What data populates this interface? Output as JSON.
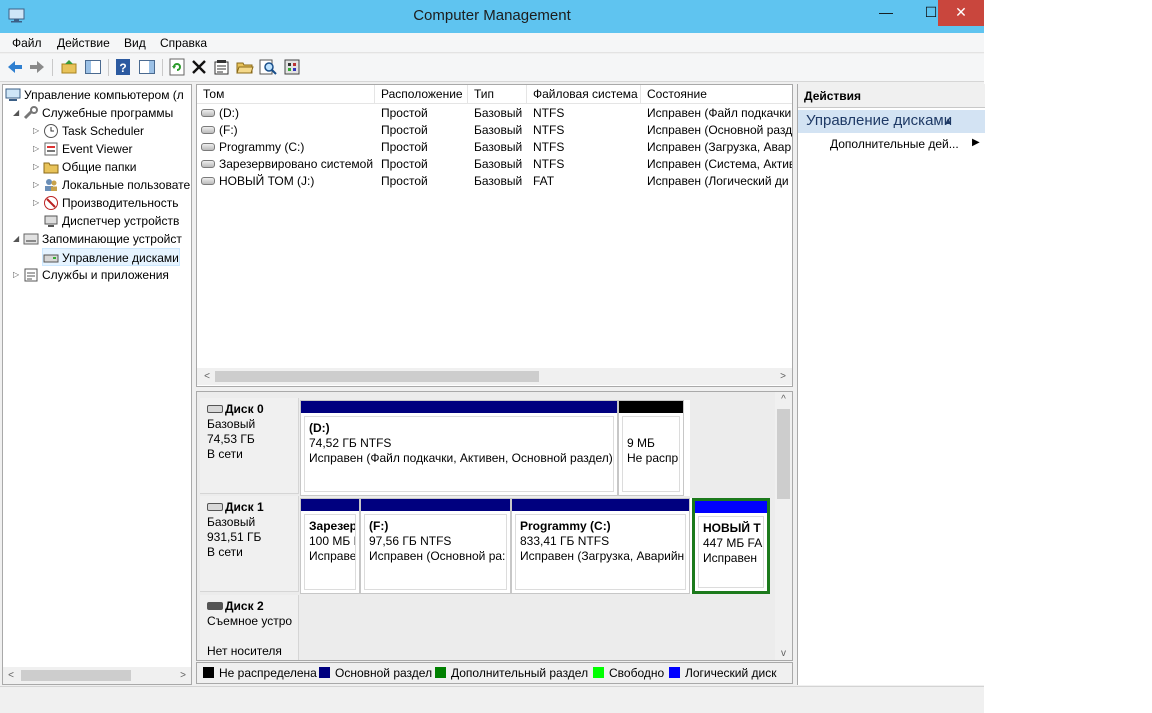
{
  "window": {
    "title": "Computer Management",
    "controls": {
      "minimize": "—",
      "maximize": "☐",
      "close": "✕"
    }
  },
  "menu": [
    "Файл",
    "Действие",
    "Вид",
    "Справка"
  ],
  "toolbar_icons": [
    "back-icon",
    "forward-icon",
    "up-folder-icon",
    "show-hide-tree-icon",
    "help-icon",
    "show-hide-action-icon",
    "refresh-icon",
    "delete-icon",
    "properties-icon",
    "open-icon",
    "search-icon",
    "settings-icon"
  ],
  "tree": {
    "items": [
      {
        "label": "Управление компьютером (л",
        "icon": "computer-icon"
      },
      {
        "label": "Служебные программы",
        "icon": "tools-icon"
      },
      {
        "label": "Task Scheduler",
        "icon": "clock-icon"
      },
      {
        "label": "Event Viewer",
        "icon": "event-viewer-icon"
      },
      {
        "label": "Общие папки",
        "icon": "shared-folder-icon"
      },
      {
        "label": "Локальные пользовате",
        "icon": "users-icon"
      },
      {
        "label": "Производительность",
        "icon": "performance-icon"
      },
      {
        "label": "Диспетчер устройств",
        "icon": "device-manager-icon"
      },
      {
        "label": "Запоминающие устройст",
        "icon": "storage-icon"
      },
      {
        "label": "Управление дисками",
        "icon": "disk-management-icon"
      },
      {
        "label": "Службы и приложения",
        "icon": "services-icon"
      }
    ]
  },
  "volumes": {
    "columns": [
      "Том",
      "Расположение",
      "Тип",
      "Файловая система",
      "Состояние"
    ],
    "rows": [
      [
        "(D:)",
        "Простой",
        "Базовый",
        "NTFS",
        "Исправен (Файл подкачки"
      ],
      [
        "(F:)",
        "Простой",
        "Базовый",
        "NTFS",
        "Исправен (Основной разд"
      ],
      [
        "Programmy (C:)",
        "Простой",
        "Базовый",
        "NTFS",
        "Исправен (Загрузка, Авар"
      ],
      [
        "Зарезервировано системой",
        "Простой",
        "Базовый",
        "NTFS",
        "Исправен (Система, Актив"
      ],
      [
        "НОВЫЙ ТОМ (J:)",
        "Простой",
        "Базовый",
        "FAT",
        "Исправен (Логический ди"
      ]
    ]
  },
  "disks": [
    {
      "name": "Диск 0",
      "type": "Базовый",
      "size": "74,53 ГБ",
      "status": "В сети",
      "partitions": [
        {
          "name": "(D:)",
          "size": "74,52 ГБ NTFS",
          "state": "Исправен (Файл подкачки, Активен, Основной раздел)",
          "bar": "#00007f"
        },
        {
          "name": "",
          "size": "9 МБ",
          "state": "Не распр",
          "bar": "#000000"
        }
      ]
    },
    {
      "name": "Диск 1",
      "type": "Базовый",
      "size": "931,51 ГБ",
      "status": "В сети",
      "partitions": [
        {
          "name": "Зарезер",
          "size": "100 МБ I",
          "state": "Исправе",
          "bar": "#00007f"
        },
        {
          "name": "(F:)",
          "size": "97,56 ГБ NTFS",
          "state": "Исправен (Основной ра:",
          "bar": "#00007f"
        },
        {
          "name": "Programmy  (C:)",
          "size": "833,41 ГБ NTFS",
          "state": "Исправен (Загрузка, Аварийн",
          "bar": "#00007f"
        },
        {
          "name": "НОВЫЙ Т",
          "size": "447 МБ FA",
          "state": "Исправен",
          "bar": "#0000ff"
        }
      ]
    },
    {
      "name": "Диск 2",
      "type": "Съемное устро",
      "size": "",
      "status": "Нет носителя",
      "partitions": []
    }
  ],
  "legend": [
    {
      "label": "Не распределена",
      "color": "#000000"
    },
    {
      "label": "Основной раздел",
      "color": "#00007f"
    },
    {
      "label": "Дополнительный раздел",
      "color": "#008000"
    },
    {
      "label": "Свободно",
      "color": "#00ff00"
    },
    {
      "label": "Логический диск",
      "color": "#0000ff"
    }
  ],
  "actions": {
    "header": "Действия",
    "group": "Управление дисками",
    "item": "Дополнительные дей..."
  }
}
